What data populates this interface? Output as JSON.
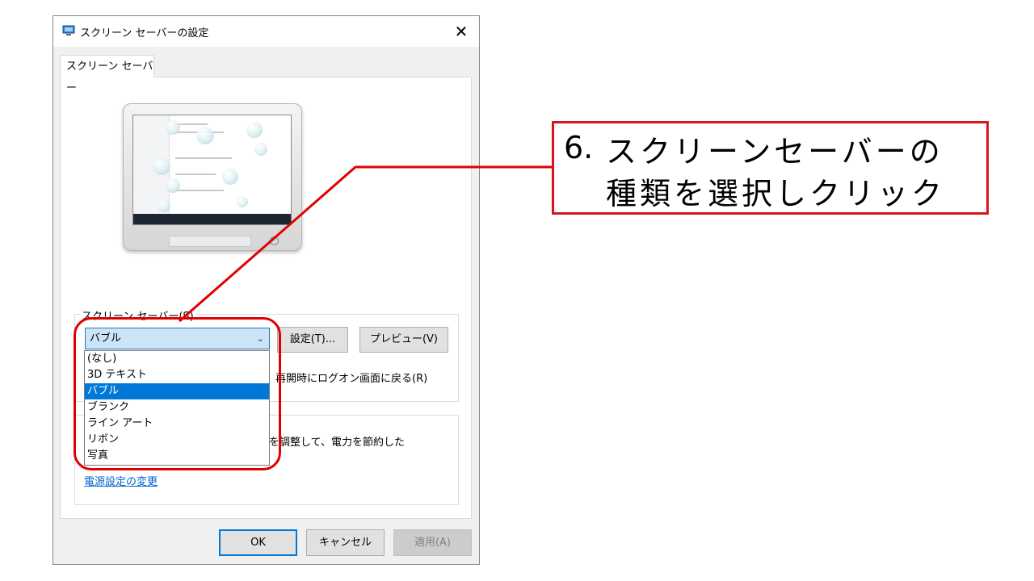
{
  "dialog": {
    "title": "スクリーン セーバーの設定",
    "close_glyph": "✕",
    "tab_label": "スクリーン セーバー"
  },
  "screensaver": {
    "group_label": "スクリーン セーバー(S)",
    "selected": "バブル",
    "settings_button": "設定(T)...",
    "preview_button": "プレビュー(V)",
    "resume_logon_partial": "再開時にログオン画面に戻る(R)",
    "options": [
      "(なし)",
      "3D テキスト",
      "バブル",
      "ブランク",
      "ライン アート",
      "リボン",
      "写真"
    ],
    "highlighted_index": 2
  },
  "power": {
    "partial_text": "を調整して、電力を節約した",
    "link": "電源設定の変更"
  },
  "footer": {
    "ok": "OK",
    "cancel": "キャンセル",
    "apply": "適用(A)"
  },
  "callout": {
    "number": "6.",
    "line1": "スクリーンセーバーの",
    "line2": "種類を選択しクリック"
  },
  "colors": {
    "annotation_red": "#e00000",
    "selection_blue": "#0078d7",
    "link_blue": "#0066cc"
  },
  "icons": {
    "title_icon": "monitor-icon",
    "close": "close-icon",
    "dropdown": "chevron-down-icon"
  }
}
